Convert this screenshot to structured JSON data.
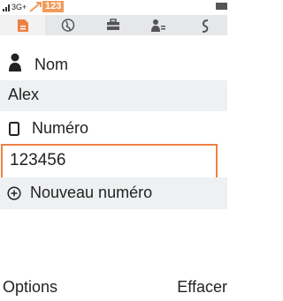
{
  "status_bar": {
    "network": "3G+",
    "badge_count": "123",
    "icons": [
      "signal-icon",
      "sms-icon",
      "battery-icon"
    ]
  },
  "tabs": [
    {
      "icon": "contact-card-icon",
      "active": true,
      "accent": "#ee8045"
    },
    {
      "icon": "globe-icon",
      "active": false
    },
    {
      "icon": "briefcase-icon",
      "active": false
    },
    {
      "icon": "person-details-icon",
      "active": false
    },
    {
      "icon": "more-icon",
      "active": false
    }
  ],
  "form": {
    "name_label": "Nom",
    "name_icon": "person-icon",
    "name_value": "Alex",
    "number_label": "Numéro",
    "number_icon": "phone-icon",
    "number_value": "123456",
    "new_number_label": "Nouveau numéro",
    "new_number_icon": "add-circle-icon"
  },
  "softkeys": {
    "left": "Options",
    "right": "Effacer"
  },
  "colors": {
    "accent": "#ee8045",
    "badge": "#f29b5a",
    "tab_bar": "#e5e7ea",
    "row_highlight": "#eef0f2"
  }
}
